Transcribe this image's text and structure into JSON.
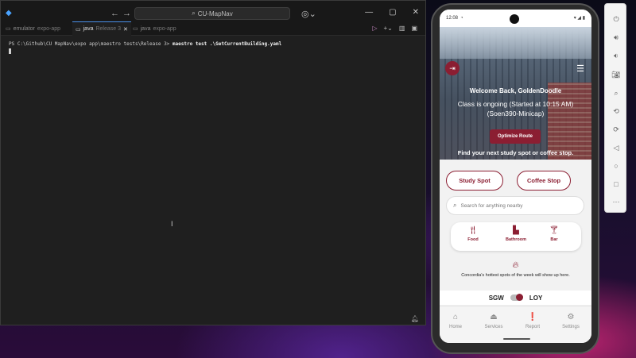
{
  "terminal": {
    "title_search": "CU-MapNav",
    "tabs": [
      {
        "label": "emulator",
        "sub": "expo-app"
      },
      {
        "label": "java",
        "sub": "Release 3"
      },
      {
        "label": "java",
        "sub": "expo-app"
      }
    ],
    "prompt": "PS C:\\Github\\CU MapNav\\expo app\\maestro tests\\Release 3>",
    "command": "maestro test .\\GetCurrentBuilding.yaml"
  },
  "phone": {
    "time": "12:08",
    "welcome": "Welcome Back, GoldenDoodle",
    "class_status": "Class is ongoing (Started at 10:15 AM)",
    "class_name": "(Soen390-Minicap)",
    "optimize_label": "Optimize Route",
    "find_text": "Find your next study spot or coffee stop.",
    "study_spot_label": "Study Spot",
    "coffee_stop_label": "Coffee Stop",
    "search_placeholder": "Search for anything nearby",
    "categories": [
      {
        "label": "Food",
        "icon": "utensils-icon"
      },
      {
        "label": "Bathroom",
        "icon": "toilet-icon"
      },
      {
        "label": "Bar",
        "icon": "cocktail-icon"
      }
    ],
    "hotspots_text": "Concordia's hottest spots of the week will show up here.",
    "campus_left": "SGW",
    "campus_right": "LOY",
    "nav": [
      {
        "label": "Home"
      },
      {
        "label": "Services"
      },
      {
        "label": "Report"
      },
      {
        "label": "Settings"
      }
    ],
    "accent": "#8b1e32"
  },
  "emulator_tools": [
    "power-icon",
    "volume-up-icon",
    "volume-down-icon",
    "camera-icon",
    "zoom-icon",
    "rotate-left-icon",
    "rotate-right-icon",
    "back-icon",
    "home-icon",
    "overview-icon",
    "more-icon"
  ]
}
